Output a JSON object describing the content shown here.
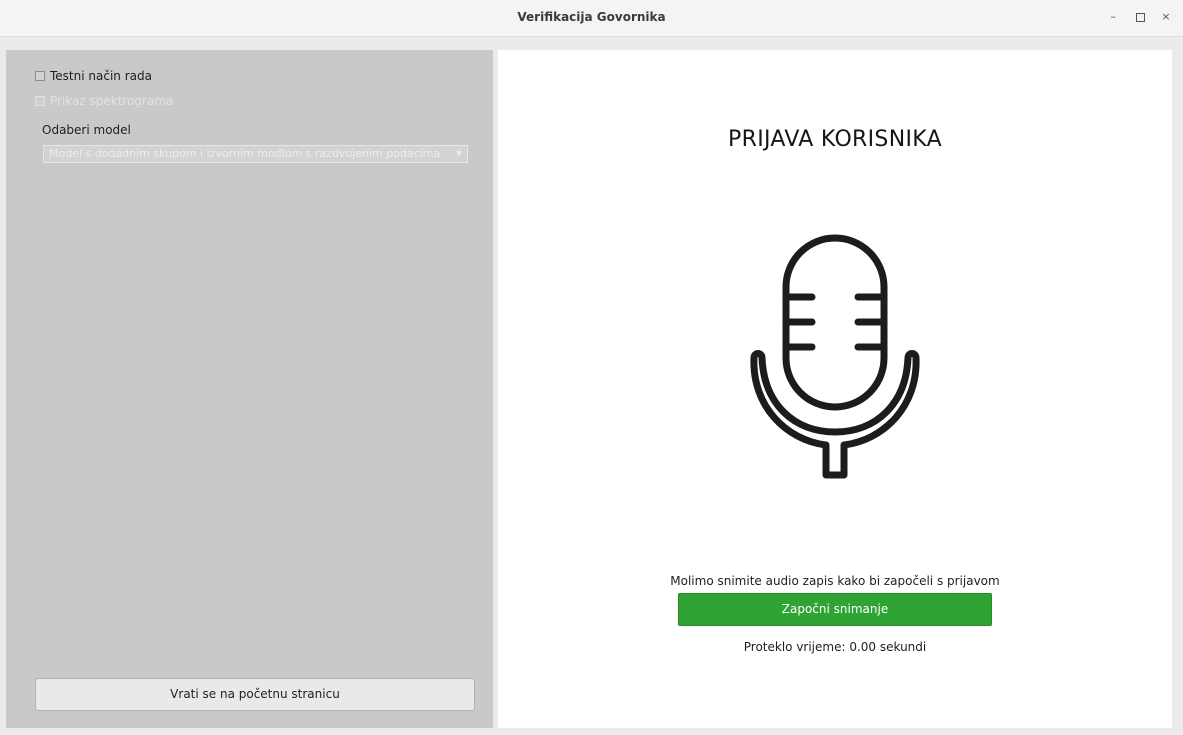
{
  "window": {
    "title": "Verifikacija Govornika",
    "controls": {
      "minimize": "–",
      "maximize": "□",
      "close": "×"
    }
  },
  "sidebar": {
    "test_mode": {
      "label": "Testni način rada",
      "checked": false
    },
    "spectrogram": {
      "label": "Prikaz spektrograma",
      "checked": false,
      "enabled": false
    },
    "model_label": "Odaberi model",
    "model_select": {
      "value": "Model s dodadnim skupom i izvornim modlom s razdvojenim podacima",
      "enabled": false
    },
    "back_button": "Vrati se na početnu stranicu"
  },
  "main": {
    "heading": "PRIJAVA KORISNIKA",
    "icon": "microphone-icon",
    "instruction": "Molimo snimite audio zapis kako bi započeli s prijavom",
    "record_button": "Započni snimanje",
    "elapsed": "Proteklo vrijeme: 0.00 sekundi",
    "accent_color": "#2fa334"
  }
}
